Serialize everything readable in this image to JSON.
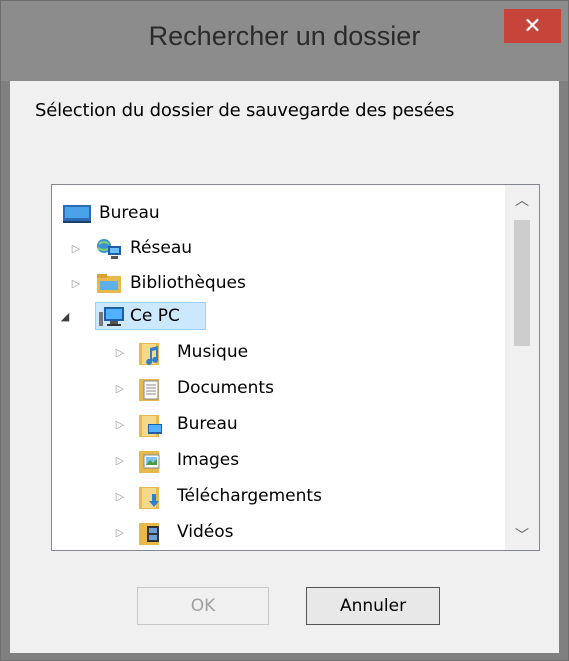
{
  "window": {
    "title": "Rechercher un dossier",
    "close_label": "✕"
  },
  "instruction": "Sélection du dossier de sauvegarde des pesées",
  "tree": {
    "items": [
      {
        "label": "Bureau",
        "icon": "desktop-icon",
        "expander": ""
      },
      {
        "label": "Réseau",
        "icon": "network-icon",
        "expander": "▷"
      },
      {
        "label": "Bibliothèques",
        "icon": "libraries-icon",
        "expander": "▷"
      },
      {
        "label": "Ce PC",
        "icon": "computer-icon",
        "expander": "◢",
        "selected": true
      },
      {
        "label": "Musique",
        "icon": "music-folder-icon",
        "expander": "▷"
      },
      {
        "label": "Documents",
        "icon": "documents-folder-icon",
        "expander": "▷"
      },
      {
        "label": "Bureau",
        "icon": "desktop-folder-icon",
        "expander": "▷"
      },
      {
        "label": "Images",
        "icon": "pictures-folder-icon",
        "expander": "▷"
      },
      {
        "label": "Téléchargements",
        "icon": "downloads-folder-icon",
        "expander": "▷"
      },
      {
        "label": "Vidéos",
        "icon": "videos-folder-icon",
        "expander": "▷"
      }
    ]
  },
  "scrollbar": {
    "up": "︿",
    "down": "﹀"
  },
  "buttons": {
    "ok": "OK",
    "cancel": "Annuler"
  },
  "colors": {
    "close": "#c7443a",
    "selection": "#cce8ff"
  }
}
